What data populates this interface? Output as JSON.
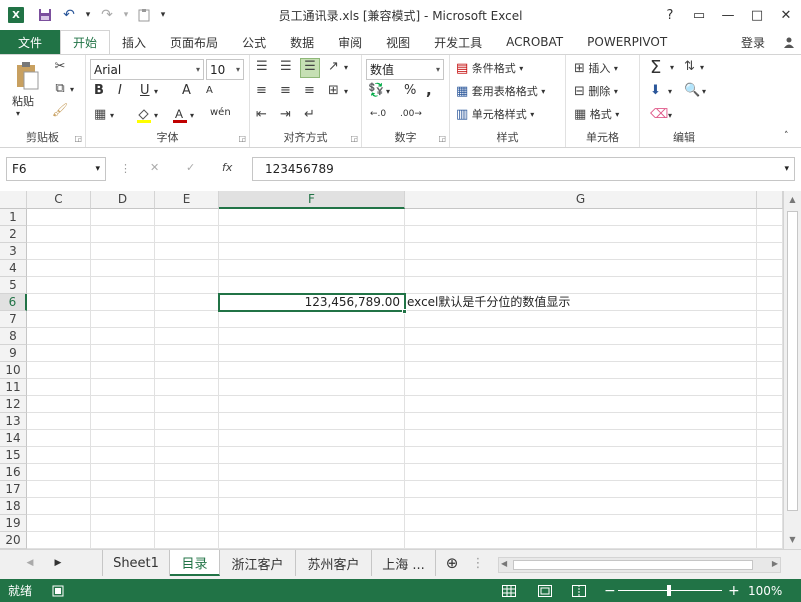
{
  "window": {
    "title": "员工通讯录.xls  [兼容模式] - Microsoft Excel",
    "logo": "X",
    "help": "?",
    "restore_ribbon": "▭",
    "minimize": "—",
    "maximize": "□",
    "close": "✕"
  },
  "qat": {
    "save": "save-icon",
    "undo": "↶",
    "redo": "↷",
    "dropdown": "▾",
    "customize": "▾"
  },
  "tabs": [
    "文件",
    "开始",
    "插入",
    "页面布局",
    "公式",
    "数据",
    "审阅",
    "视图",
    "开发工具",
    "ACROBAT",
    "POWERPIVOT"
  ],
  "signin": "登录",
  "ribbon": {
    "clipboard": {
      "label": "剪贴板",
      "paste": "粘贴"
    },
    "font": {
      "label": "字体",
      "name": "Arial",
      "size": "10",
      "bold": "B",
      "italic": "I",
      "underline": "U",
      "grow": "A",
      "shrink": "A",
      "phonetic": "wén"
    },
    "alignment": {
      "label": "对齐方式"
    },
    "number": {
      "label": "数字",
      "format": "数值",
      "percent": "%",
      "comma": ","
    },
    "styles": {
      "label": "样式",
      "conditional": "条件格式",
      "table": "套用表格格式",
      "cell": "单元格样式"
    },
    "cells": {
      "label": "单元格",
      "insert": "插入",
      "delete": "删除",
      "format": "格式"
    },
    "editing": {
      "label": "编辑",
      "sum": "Σ"
    }
  },
  "formula_bar": {
    "name_box": "F6",
    "cancel": "✕",
    "enter": "✓",
    "fx": "fx",
    "value": "123456789"
  },
  "grid": {
    "columns": [
      "C",
      "D",
      "E",
      "F",
      "G"
    ],
    "rows": [
      "1",
      "2",
      "3",
      "4",
      "5",
      "6",
      "7",
      "8",
      "9",
      "10",
      "11",
      "12",
      "13",
      "14",
      "15",
      "16",
      "17",
      "18",
      "19",
      "20"
    ],
    "selected_cell": "F6",
    "f6_display": "123,456,789.00",
    "g6_text": "excel默认是千分位的数值显示"
  },
  "sheets": [
    "Sheet1",
    "目录",
    "浙江客户",
    "苏州客户",
    "上海 ..."
  ],
  "active_sheet": "目录",
  "status": {
    "ready": "就绪",
    "zoom": "100%",
    "minus": "−",
    "plus": "+"
  }
}
